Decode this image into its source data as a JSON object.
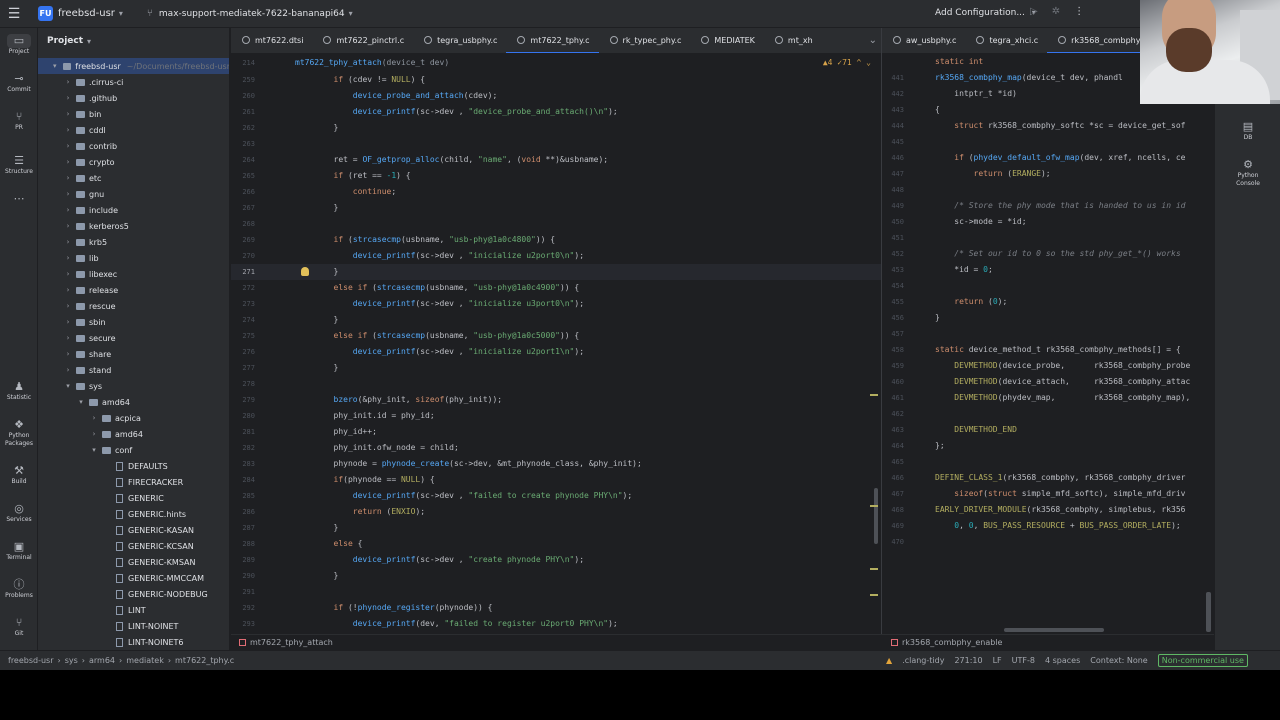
{
  "titlebar": {
    "project_badge": "FU",
    "project_name": "freebsd-usr",
    "branch": "max-support-mediatek-7622-bananapi64",
    "run_config": "Add Configuration..."
  },
  "left_strip": [
    {
      "name": "project",
      "label": "Project",
      "icon": "▭"
    },
    {
      "name": "commit",
      "label": "Commit",
      "icon": "⊸"
    },
    {
      "name": "pull-requests",
      "label": "PR",
      "icon": "⑂"
    },
    {
      "name": "structure",
      "label": "Structure",
      "icon": "☰"
    },
    {
      "name": "more",
      "label": "",
      "icon": "⋯"
    },
    {
      "name": "statistic",
      "label": "Statistic",
      "icon": "♟"
    },
    {
      "name": "python-packages",
      "label": "Python Packages",
      "icon": "❖"
    },
    {
      "name": "build",
      "label": "Build",
      "icon": "⚒"
    },
    {
      "name": "services",
      "label": "Services",
      "icon": "◎"
    },
    {
      "name": "terminal",
      "label": "Terminal",
      "icon": "▣"
    },
    {
      "name": "problems",
      "label": "Problems",
      "icon": "ⓘ"
    },
    {
      "name": "git",
      "label": "Git",
      "icon": "⑂"
    }
  ],
  "right_strip": [
    {
      "name": "db",
      "label": "DB",
      "icon": "▤"
    },
    {
      "name": "python-console",
      "label": "Python Console",
      "icon": "⚙"
    }
  ],
  "project_panel": {
    "title": "Project",
    "root": {
      "label": "freebsd-usr",
      "path": "~/Documents/freebsd-usr"
    },
    "items": [
      {
        "label": ".cirrus-ci",
        "depth": 1,
        "type": "folder",
        "expanded": false
      },
      {
        "label": ".github",
        "depth": 1,
        "type": "folder",
        "expanded": false
      },
      {
        "label": "bin",
        "depth": 1,
        "type": "folder",
        "expanded": false
      },
      {
        "label": "cddl",
        "depth": 1,
        "type": "folder",
        "expanded": false
      },
      {
        "label": "contrib",
        "depth": 1,
        "type": "folder",
        "expanded": false
      },
      {
        "label": "crypto",
        "depth": 1,
        "type": "folder",
        "expanded": false
      },
      {
        "label": "etc",
        "depth": 1,
        "type": "folder",
        "expanded": false
      },
      {
        "label": "gnu",
        "depth": 1,
        "type": "folder",
        "expanded": false
      },
      {
        "label": "include",
        "depth": 1,
        "type": "folder",
        "expanded": false
      },
      {
        "label": "kerberos5",
        "depth": 1,
        "type": "folder",
        "expanded": false
      },
      {
        "label": "krb5",
        "depth": 1,
        "type": "folder",
        "expanded": false
      },
      {
        "label": "lib",
        "depth": 1,
        "type": "folder",
        "expanded": false
      },
      {
        "label": "libexec",
        "depth": 1,
        "type": "folder",
        "expanded": false
      },
      {
        "label": "release",
        "depth": 1,
        "type": "folder",
        "expanded": false
      },
      {
        "label": "rescue",
        "depth": 1,
        "type": "folder",
        "expanded": false
      },
      {
        "label": "sbin",
        "depth": 1,
        "type": "folder",
        "expanded": false
      },
      {
        "label": "secure",
        "depth": 1,
        "type": "folder",
        "expanded": false
      },
      {
        "label": "share",
        "depth": 1,
        "type": "folder",
        "expanded": false
      },
      {
        "label": "stand",
        "depth": 1,
        "type": "folder",
        "expanded": false
      },
      {
        "label": "sys",
        "depth": 1,
        "type": "folder",
        "expanded": true
      },
      {
        "label": "amd64",
        "depth": 2,
        "type": "folder",
        "expanded": true
      },
      {
        "label": "acpica",
        "depth": 3,
        "type": "folder",
        "expanded": false
      },
      {
        "label": "amd64",
        "depth": 3,
        "type": "folder",
        "expanded": false
      },
      {
        "label": "conf",
        "depth": 3,
        "type": "folder",
        "expanded": true
      },
      {
        "label": "DEFAULTS",
        "depth": 4,
        "type": "file"
      },
      {
        "label": "FIRECRACKER",
        "depth": 4,
        "type": "file"
      },
      {
        "label": "GENERIC",
        "depth": 4,
        "type": "file"
      },
      {
        "label": "GENERIC.hints",
        "depth": 4,
        "type": "file"
      },
      {
        "label": "GENERIC-KASAN",
        "depth": 4,
        "type": "file"
      },
      {
        "label": "GENERIC-KCSAN",
        "depth": 4,
        "type": "file"
      },
      {
        "label": "GENERIC-KMSAN",
        "depth": 4,
        "type": "file"
      },
      {
        "label": "GENERIC-MMCCAM",
        "depth": 4,
        "type": "file"
      },
      {
        "label": "GENERIC-NODEBUG",
        "depth": 4,
        "type": "file"
      },
      {
        "label": "LINT",
        "depth": 4,
        "type": "file"
      },
      {
        "label": "LINT-NOINET",
        "depth": 4,
        "type": "file"
      },
      {
        "label": "LINT-NOINET6",
        "depth": 4,
        "type": "file"
      }
    ]
  },
  "tabs_left": [
    {
      "label": "mt7622.dtsi",
      "active": false
    },
    {
      "label": "mt7622_pinctrl.c",
      "active": false
    },
    {
      "label": "tegra_usbphy.c",
      "active": false
    },
    {
      "label": "mt7622_tphy.c",
      "active": true
    },
    {
      "label": "rk_typec_phy.c",
      "active": false
    },
    {
      "label": "MEDIATEK",
      "active": false
    },
    {
      "label": "mt_xh",
      "active": false
    }
  ],
  "tabs_right": [
    {
      "label": "aw_usbphy.c",
      "active": false
    },
    {
      "label": "tegra_xhci.c",
      "active": false
    },
    {
      "label": "rk3568_combphy",
      "active": true
    }
  ],
  "editor_left": {
    "sticky_line_no": "214",
    "sticky_func": "mt7622_tphy_attach",
    "sticky_args": "(device_t dev)",
    "inspection": "▲4  ✓71  ^  ⌄",
    "current_line": "271",
    "lines": [
      {
        "no": "259",
        "code": "        if (cdev != NULL) {"
      },
      {
        "no": "260",
        "code": "            device_probe_and_attach(cdev);"
      },
      {
        "no": "261",
        "code": "            device_printf(sc->dev , \"device_probe_and_attach()\\n\");"
      },
      {
        "no": "262",
        "code": "        }"
      },
      {
        "no": "263",
        "code": ""
      },
      {
        "no": "264",
        "code": "        ret = OF_getprop_alloc(child, \"name\", (void **)&usbname);"
      },
      {
        "no": "265",
        "code": "        if (ret == -1) {"
      },
      {
        "no": "266",
        "code": "            continue;"
      },
      {
        "no": "267",
        "code": "        }"
      },
      {
        "no": "268",
        "code": ""
      },
      {
        "no": "269",
        "code": "        if (strcasecmp(usbname, \"usb-phy@1a0c4800\")) {"
      },
      {
        "no": "270",
        "code": "            device_printf(sc->dev , \"inicialize u2port0\\n\");"
      },
      {
        "no": "271",
        "code": "        }"
      },
      {
        "no": "272",
        "code": "        else if (strcasecmp(usbname, \"usb-phy@1a0c4900\")) {"
      },
      {
        "no": "273",
        "code": "            device_printf(sc->dev , \"inicialize u3port0\\n\");"
      },
      {
        "no": "274",
        "code": "        }"
      },
      {
        "no": "275",
        "code": "        else if (strcasecmp(usbname, \"usb-phy@1a0c5000\")) {"
      },
      {
        "no": "276",
        "code": "            device_printf(sc->dev , \"inicialize u2port1\\n\");"
      },
      {
        "no": "277",
        "code": "        }"
      },
      {
        "no": "278",
        "code": ""
      },
      {
        "no": "279",
        "code": "        bzero(&phy_init, sizeof(phy_init));"
      },
      {
        "no": "280",
        "code": "        phy_init.id = phy_id;"
      },
      {
        "no": "281",
        "code": "        phy_id++;"
      },
      {
        "no": "282",
        "code": "        phy_init.ofw_node = child;"
      },
      {
        "no": "283",
        "code": "        phynode = phynode_create(sc->dev, &mt_phynode_class, &phy_init);"
      },
      {
        "no": "284",
        "code": "        if(phynode == NULL) {"
      },
      {
        "no": "285",
        "code": "            device_printf(sc->dev , \"failed to create phynode PHY\\n\");"
      },
      {
        "no": "286",
        "code": "            return (ENXIO);"
      },
      {
        "no": "287",
        "code": "        }"
      },
      {
        "no": "288",
        "code": "        else {"
      },
      {
        "no": "289",
        "code": "            device_printf(sc->dev , \"create phynode PHY\\n\");"
      },
      {
        "no": "290",
        "code": "        }"
      },
      {
        "no": "291",
        "code": ""
      },
      {
        "no": "292",
        "code": "        if (!phynode_register(phynode)) {"
      },
      {
        "no": "293",
        "code": "            device_printf(dev, \"failed to register u2port0 PHY\\n\");"
      }
    ]
  },
  "editor_right": {
    "inspection": "▲6  ✓2",
    "lines": [
      {
        "no": "",
        "code": "static int"
      },
      {
        "no": "441",
        "code": "rk3568_combphy_map(device_t dev, phandl"
      },
      {
        "no": "442",
        "code": "    intptr_t *id)"
      },
      {
        "no": "443",
        "code": "{"
      },
      {
        "no": "444",
        "code": "    struct rk3568_combphy_softc *sc = device_get_sof"
      },
      {
        "no": "445",
        "code": ""
      },
      {
        "no": "446",
        "code": "    if (phydev_default_ofw_map(dev, xref, ncells, ce"
      },
      {
        "no": "447",
        "code": "        return (ERANGE);"
      },
      {
        "no": "448",
        "code": ""
      },
      {
        "no": "449",
        "code": "    /* Store the phy mode that is handed to us in id"
      },
      {
        "no": "450",
        "code": "    sc->mode = *id;"
      },
      {
        "no": "451",
        "code": ""
      },
      {
        "no": "452",
        "code": "    /* Set our id to 0 so the std phy_get_*() works "
      },
      {
        "no": "453",
        "code": "    *id = 0;"
      },
      {
        "no": "454",
        "code": ""
      },
      {
        "no": "455",
        "code": "    return (0);"
      },
      {
        "no": "456",
        "code": "}"
      },
      {
        "no": "457",
        "code": ""
      },
      {
        "no": "458",
        "code": "static device_method_t rk3568_combphy_methods[] = {"
      },
      {
        "no": "459",
        "code": "    DEVMETHOD(device_probe,      rk3568_combphy_probe"
      },
      {
        "no": "460",
        "code": "    DEVMETHOD(device_attach,     rk3568_combphy_attac"
      },
      {
        "no": "461",
        "code": "    DEVMETHOD(phydev_map,        rk3568_combphy_map),"
      },
      {
        "no": "462",
        "code": ""
      },
      {
        "no": "463",
        "code": "    DEVMETHOD_END"
      },
      {
        "no": "464",
        "code": "};"
      },
      {
        "no": "465",
        "code": ""
      },
      {
        "no": "466",
        "code": "DEFINE_CLASS_1(rk3568_combphy, rk3568_combphy_driver"
      },
      {
        "no": "467",
        "code": "    sizeof(struct simple_mfd_softc), simple_mfd_driv"
      },
      {
        "no": "468",
        "code": "EARLY_DRIVER_MODULE(rk3568_combphy, simplebus, rk356"
      },
      {
        "no": "469",
        "code": "    0, 0, BUS_PASS_RESOURCE + BUS_PASS_ORDER_LATE);"
      },
      {
        "no": "470",
        "code": ""
      }
    ]
  },
  "editor_bottom": {
    "left_scope": "mt7622_tphy_attach",
    "right_scope": "rk3568_combphy_enable"
  },
  "statusbar": {
    "breadcrumbs": [
      "freebsd-usr",
      "sys",
      "arm64",
      "mediatek",
      "mt7622_tphy.c"
    ],
    "linter": ".clang-tidy",
    "position": "271:10",
    "line_ending": "LF",
    "encoding": "UTF-8",
    "indent": "4 spaces",
    "context": "Context: None",
    "license": "Non-commercial use"
  }
}
